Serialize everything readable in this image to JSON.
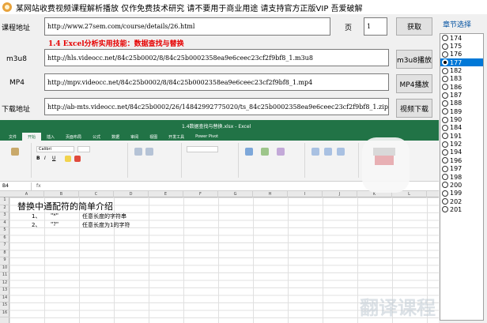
{
  "window": {
    "title": "某网站收费视频课程解析播放 仅作免费技术研究 请不要用于商业用途 请支持官方正版VIP 吾爱破解"
  },
  "course": {
    "label": "课程地址",
    "url": "http://www.27sem.com/course/details/26.html",
    "page_label": "页",
    "page_value": "1",
    "fetch_button": "获取"
  },
  "note": "1.4 Excel分析实用技能：数据查找与替换",
  "m3u8": {
    "label": "m3u8",
    "url": "http://hls.videocc.net/84c25b0002/8/84c25b0002358ea9e6ceec23cf2f9bf8_1.m3u8",
    "button": "m3u8播放"
  },
  "mp4": {
    "label": "MP4",
    "url": "http://mpv.videocc.net/84c25b0002/8/84c25b0002358ea9e6ceec23cf2f9bf8_1.mp4",
    "button": "MP4播放"
  },
  "download": {
    "label": "下载地址",
    "url": "http://ab-mts.videocc.net/84c25b0002/26/14842992775020/ts_84c25b0002358ea9e6ceec23cf2f9bf8_1.zip",
    "button": "视频下载"
  },
  "chapters": {
    "header": "章节选择",
    "items": [
      "174",
      "175",
      "176",
      "177",
      "182",
      "183",
      "186",
      "187",
      "188",
      "189",
      "190",
      "184",
      "191",
      "192",
      "194",
      "196",
      "197",
      "198",
      "200",
      "199",
      "202",
      "201"
    ],
    "selected": "177"
  },
  "video": {
    "excel_title": "1.4数据查找与替换.xlsx - Excel",
    "tabs": [
      "文件",
      "开始",
      "插入",
      "页面布局",
      "公式",
      "数据",
      "审阅",
      "视图",
      "开发工具",
      "Power Pivot"
    ],
    "active_tab": "开始",
    "name_box": "B4",
    "font_name": "Calibri",
    "columns": [
      "A",
      "B",
      "C",
      "D",
      "E",
      "F",
      "G",
      "H",
      "I",
      "J",
      "K",
      "L"
    ],
    "rows": [
      "1",
      "2",
      "3",
      "4",
      "5",
      "6",
      "7",
      "8",
      "9",
      "10",
      "11",
      "12",
      "13",
      "14",
      "15",
      "16"
    ],
    "sheet_heading": "替换中通配符的简单介绍",
    "lines": [
      {
        "num": "1、",
        "sym": "\"*\"",
        "desc": "任意长度的字符串"
      },
      {
        "num": "2、",
        "sym": "\"?\"",
        "desc": "任意长度为1的字符"
      }
    ],
    "watermark": "翻译课程"
  }
}
